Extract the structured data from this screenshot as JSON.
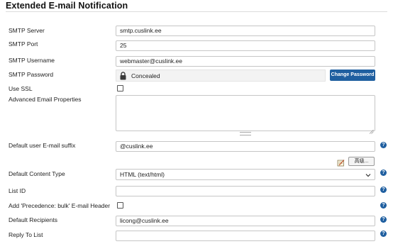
{
  "section": {
    "title": "Extended E-mail Notification"
  },
  "fields": {
    "smtp_server": {
      "label": "SMTP Server",
      "value": "smtp.cuslink.ee"
    },
    "smtp_port": {
      "label": "SMTP Port",
      "value": "25"
    },
    "smtp_username": {
      "label": "SMTP Username",
      "value": "webmaster@cuslink.ee"
    },
    "smtp_password": {
      "label": "SMTP Password",
      "value": "Concealed",
      "button": "Change Password"
    },
    "use_ssl": {
      "label": "Use SSL",
      "checked": false
    },
    "advanced_props": {
      "label": "Advanced Email Properties",
      "value": ""
    },
    "default_suffix": {
      "label": "Default user E-mail suffix",
      "value": "@cuslink.ee"
    },
    "advanced_button": {
      "label": "高级..."
    },
    "content_type": {
      "label": "Default Content Type",
      "selected": "HTML (text/html)"
    },
    "list_id": {
      "label": "List ID",
      "value": ""
    },
    "precedence": {
      "label": "Add 'Precedence: bulk' E-mail Header",
      "checked": false
    },
    "default_recipients": {
      "label": "Default Recipients",
      "value": "licong@cuslink.ee"
    },
    "reply_to": {
      "label": "Reply To List",
      "value": ""
    }
  },
  "help_glyph": "?",
  "colors": {
    "accent": "#1f5fa0",
    "border": "#c6c6c6",
    "concealed_bg": "#f3f3f3"
  },
  "icons": {
    "lock": "lock-icon",
    "help": "help-icon",
    "notepad": "notepad-icon",
    "chevron": "chevron-down-icon"
  }
}
